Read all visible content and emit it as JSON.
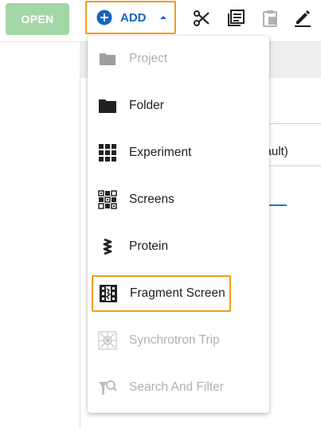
{
  "toolbar": {
    "open_label": "OPEN",
    "add_label": "ADD",
    "tools": [
      {
        "icon": "scissors-icon"
      },
      {
        "icon": "copy-icon"
      },
      {
        "icon": "paste-icon"
      },
      {
        "icon": "edit-icon"
      }
    ]
  },
  "background": {
    "text": "efault)"
  },
  "add_menu": {
    "items": [
      {
        "label": "Project",
        "icon": "folder-icon",
        "enabled": false
      },
      {
        "label": "Folder",
        "icon": "folder-icon",
        "enabled": true
      },
      {
        "label": "Experiment",
        "icon": "grid-icon",
        "enabled": true
      },
      {
        "label": "Screens",
        "icon": "screens-icon",
        "enabled": true
      },
      {
        "label": "Protein",
        "icon": "protein-icon",
        "enabled": true
      },
      {
        "label": "Fragment Screen",
        "icon": "fragment-screen-icon",
        "enabled": true,
        "highlighted": true
      },
      {
        "label": "Synchrotron Trip",
        "icon": "synchrotron-icon",
        "enabled": false
      },
      {
        "label": "Search And Filter",
        "icon": "search-filter-icon",
        "enabled": false
      }
    ]
  },
  "colors": {
    "open_bg": "#a5d6a7",
    "accent_blue": "#1565c0",
    "highlight_orange": "#f29b18",
    "disabled_text": "#b0b0b0"
  }
}
